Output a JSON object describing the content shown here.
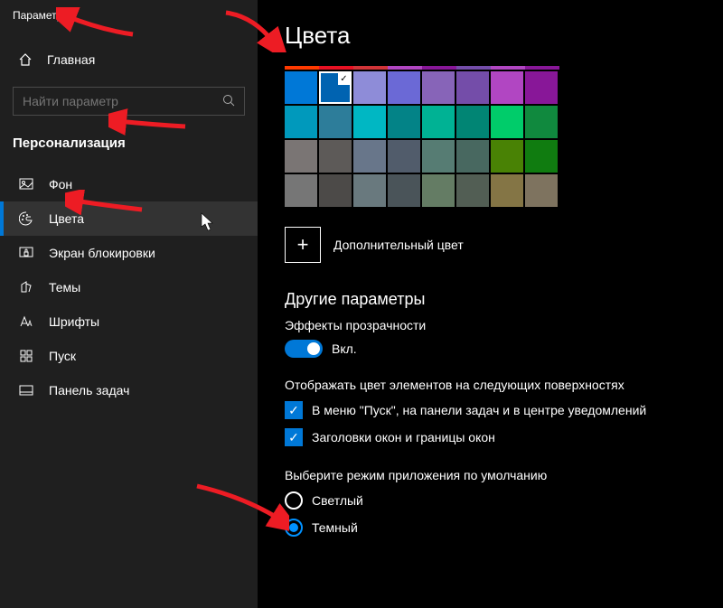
{
  "window_title": "Параметры",
  "home_label": "Главная",
  "search_placeholder": "Найти параметр",
  "category": "Персонализация",
  "nav": [
    {
      "label": "Фон"
    },
    {
      "label": "Цвета",
      "selected": true
    },
    {
      "label": "Экран блокировки"
    },
    {
      "label": "Темы"
    },
    {
      "label": "Шрифты"
    },
    {
      "label": "Пуск"
    },
    {
      "label": "Панель задач"
    }
  ],
  "page_title": "Цвета",
  "palette_top_accents": [
    "#ff3a00",
    "#e81123",
    "#d13438",
    "#b146c2",
    "#881798",
    "#744da9",
    "#b146c2",
    "#881798"
  ],
  "palette": [
    [
      "#0078d7",
      "#0063b1",
      "#8e8cd8",
      "#6b69d6",
      "#8764b8",
      "#744da9",
      "#b146c2",
      "#881798"
    ],
    [
      "#0099bc",
      "#2d7d9a",
      "#00b7c3",
      "#038387",
      "#00b294",
      "#018574",
      "#00cc6a",
      "#10893e"
    ],
    [
      "#7a7574",
      "#5d5a58",
      "#68768a",
      "#515c6b",
      "#567c73",
      "#486860",
      "#498205",
      "#107c10"
    ],
    [
      "#767676",
      "#4c4a48",
      "#69797e",
      "#4a5459",
      "#647c64",
      "#525e54",
      "#847545",
      "#7e735f"
    ]
  ],
  "selected_swatch": "0,1",
  "custom_color_label": "Дополнительный цвет",
  "section_other": "Другие параметры",
  "transparency_label": "Эффекты прозрачности",
  "toggle_on_label": "Вкл.",
  "surfaces_label": "Отображать цвет элементов на следующих поверхностях",
  "check1_label": "В меню \"Пуск\", на панели задач и в центре уведомлений",
  "check2_label": "Заголовки окон и границы окон",
  "app_mode_label": "Выберите режим приложения по умолчанию",
  "radio_light": "Светлый",
  "radio_dark": "Темный"
}
